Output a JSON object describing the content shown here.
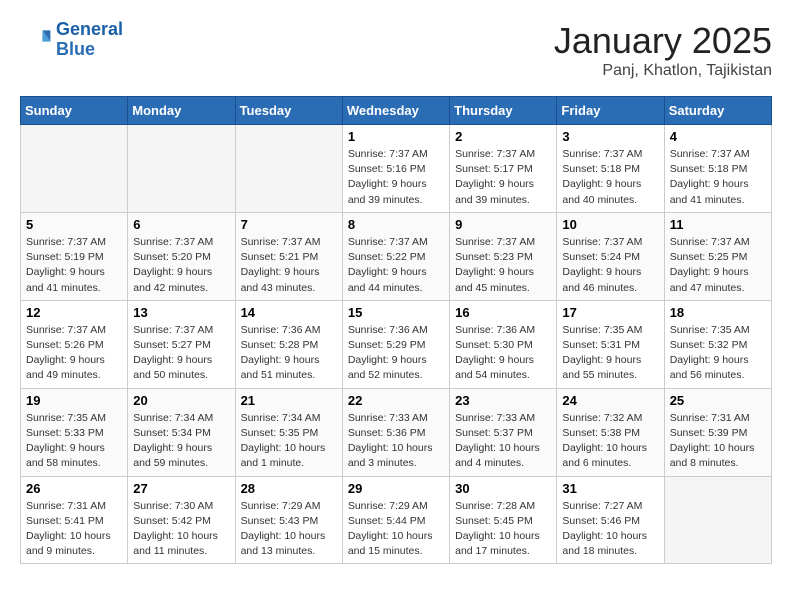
{
  "header": {
    "logo_general": "General",
    "logo_blue": "Blue",
    "month_title": "January 2025",
    "location": "Panj, Khatlon, Tajikistan"
  },
  "weekdays": [
    "Sunday",
    "Monday",
    "Tuesday",
    "Wednesday",
    "Thursday",
    "Friday",
    "Saturday"
  ],
  "weeks": [
    [
      {
        "day": "",
        "empty": true
      },
      {
        "day": "",
        "empty": true
      },
      {
        "day": "",
        "empty": true
      },
      {
        "day": "1",
        "sunrise": "7:37 AM",
        "sunset": "5:16 PM",
        "daylight": "9 hours and 39 minutes."
      },
      {
        "day": "2",
        "sunrise": "7:37 AM",
        "sunset": "5:17 PM",
        "daylight": "9 hours and 39 minutes."
      },
      {
        "day": "3",
        "sunrise": "7:37 AM",
        "sunset": "5:18 PM",
        "daylight": "9 hours and 40 minutes."
      },
      {
        "day": "4",
        "sunrise": "7:37 AM",
        "sunset": "5:18 PM",
        "daylight": "9 hours and 41 minutes."
      }
    ],
    [
      {
        "day": "5",
        "sunrise": "7:37 AM",
        "sunset": "5:19 PM",
        "daylight": "9 hours and 41 minutes."
      },
      {
        "day": "6",
        "sunrise": "7:37 AM",
        "sunset": "5:20 PM",
        "daylight": "9 hours and 42 minutes."
      },
      {
        "day": "7",
        "sunrise": "7:37 AM",
        "sunset": "5:21 PM",
        "daylight": "9 hours and 43 minutes."
      },
      {
        "day": "8",
        "sunrise": "7:37 AM",
        "sunset": "5:22 PM",
        "daylight": "9 hours and 44 minutes."
      },
      {
        "day": "9",
        "sunrise": "7:37 AM",
        "sunset": "5:23 PM",
        "daylight": "9 hours and 45 minutes."
      },
      {
        "day": "10",
        "sunrise": "7:37 AM",
        "sunset": "5:24 PM",
        "daylight": "9 hours and 46 minutes."
      },
      {
        "day": "11",
        "sunrise": "7:37 AM",
        "sunset": "5:25 PM",
        "daylight": "9 hours and 47 minutes."
      }
    ],
    [
      {
        "day": "12",
        "sunrise": "7:37 AM",
        "sunset": "5:26 PM",
        "daylight": "9 hours and 49 minutes."
      },
      {
        "day": "13",
        "sunrise": "7:37 AM",
        "sunset": "5:27 PM",
        "daylight": "9 hours and 50 minutes."
      },
      {
        "day": "14",
        "sunrise": "7:36 AM",
        "sunset": "5:28 PM",
        "daylight": "9 hours and 51 minutes."
      },
      {
        "day": "15",
        "sunrise": "7:36 AM",
        "sunset": "5:29 PM",
        "daylight": "9 hours and 52 minutes."
      },
      {
        "day": "16",
        "sunrise": "7:36 AM",
        "sunset": "5:30 PM",
        "daylight": "9 hours and 54 minutes."
      },
      {
        "day": "17",
        "sunrise": "7:35 AM",
        "sunset": "5:31 PM",
        "daylight": "9 hours and 55 minutes."
      },
      {
        "day": "18",
        "sunrise": "7:35 AM",
        "sunset": "5:32 PM",
        "daylight": "9 hours and 56 minutes."
      }
    ],
    [
      {
        "day": "19",
        "sunrise": "7:35 AM",
        "sunset": "5:33 PM",
        "daylight": "9 hours and 58 minutes."
      },
      {
        "day": "20",
        "sunrise": "7:34 AM",
        "sunset": "5:34 PM",
        "daylight": "9 hours and 59 minutes."
      },
      {
        "day": "21",
        "sunrise": "7:34 AM",
        "sunset": "5:35 PM",
        "daylight": "10 hours and 1 minute."
      },
      {
        "day": "22",
        "sunrise": "7:33 AM",
        "sunset": "5:36 PM",
        "daylight": "10 hours and 3 minutes."
      },
      {
        "day": "23",
        "sunrise": "7:33 AM",
        "sunset": "5:37 PM",
        "daylight": "10 hours and 4 minutes."
      },
      {
        "day": "24",
        "sunrise": "7:32 AM",
        "sunset": "5:38 PM",
        "daylight": "10 hours and 6 minutes."
      },
      {
        "day": "25",
        "sunrise": "7:31 AM",
        "sunset": "5:39 PM",
        "daylight": "10 hours and 8 minutes."
      }
    ],
    [
      {
        "day": "26",
        "sunrise": "7:31 AM",
        "sunset": "5:41 PM",
        "daylight": "10 hours and 9 minutes."
      },
      {
        "day": "27",
        "sunrise": "7:30 AM",
        "sunset": "5:42 PM",
        "daylight": "10 hours and 11 minutes."
      },
      {
        "day": "28",
        "sunrise": "7:29 AM",
        "sunset": "5:43 PM",
        "daylight": "10 hours and 13 minutes."
      },
      {
        "day": "29",
        "sunrise": "7:29 AM",
        "sunset": "5:44 PM",
        "daylight": "10 hours and 15 minutes."
      },
      {
        "day": "30",
        "sunrise": "7:28 AM",
        "sunset": "5:45 PM",
        "daylight": "10 hours and 17 minutes."
      },
      {
        "day": "31",
        "sunrise": "7:27 AM",
        "sunset": "5:46 PM",
        "daylight": "10 hours and 18 minutes."
      },
      {
        "day": "",
        "empty": true
      }
    ]
  ]
}
